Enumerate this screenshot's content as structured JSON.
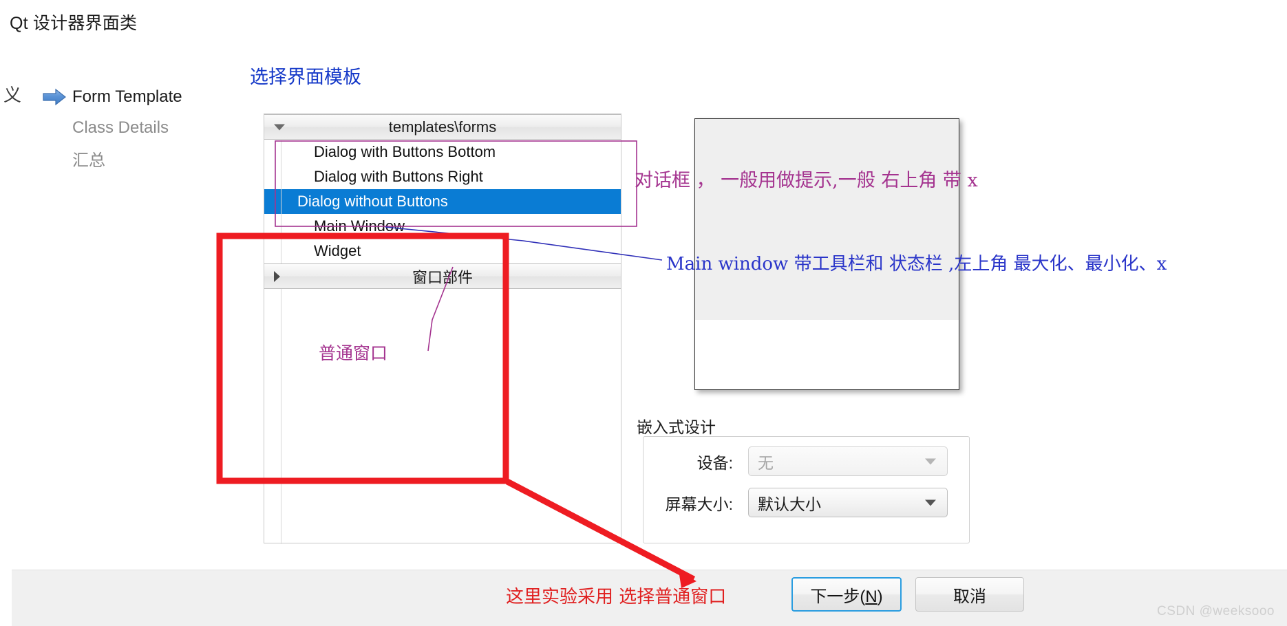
{
  "window": {
    "title": "Qt 设计器界面类"
  },
  "steps": {
    "cut_glyph": "义",
    "items": [
      {
        "label": "Form Template",
        "state": "current",
        "icon": "blue-arrow-icon"
      },
      {
        "label": "Class Details",
        "state": "pending",
        "icon": ""
      },
      {
        "label": "汇总",
        "state": "pending",
        "icon": ""
      }
    ]
  },
  "template_list": {
    "group_header": "templates\\forms",
    "group_header_2": "窗口部件",
    "items": [
      {
        "label": "Dialog with Buttons Bottom",
        "selected": false
      },
      {
        "label": "Dialog with Buttons Right",
        "selected": false
      },
      {
        "label": "Dialog without Buttons",
        "selected": true
      },
      {
        "label": "Main Window",
        "selected": false
      },
      {
        "label": "Widget",
        "selected": false
      }
    ]
  },
  "embedded": {
    "group_title": "嵌入式设计",
    "device_label": "设备:",
    "device_value": "无",
    "screen_label": "屏幕大小:",
    "screen_value": "默认大小"
  },
  "buttons": {
    "next_prefix": "下一步(",
    "next_accel": "N",
    "next_suffix": ")",
    "cancel": "取消"
  },
  "annotations": {
    "heading": "选择界面模板",
    "dialog_note": "对话框 ， 一般用做提示,一般  右上角 带   x",
    "mainwindow_note": "Main window 带工具栏和  状态栏  ,左上角 最大化、最小化、x",
    "normal_window": "普通窗口",
    "bottom_note": "这里实验采用  选择普通窗口"
  },
  "watermark": "CSDN @weeksooo",
  "colors": {
    "selection_blue": "#0a7cd4",
    "annotation_purple": "#a4338f",
    "annotation_blue": "#2a35c9",
    "annotation_red": "#e02020",
    "heading_blue": "#1438c8",
    "focus_border": "#2a9de0"
  }
}
